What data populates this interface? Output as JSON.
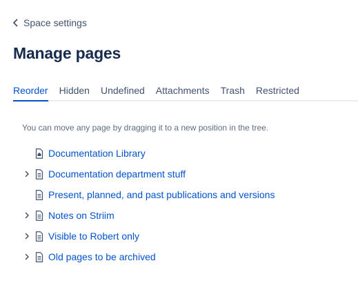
{
  "header": {
    "back_label": "Space settings",
    "title": "Manage pages"
  },
  "tabs": [
    {
      "label": "Reorder",
      "active": true
    },
    {
      "label": "Hidden",
      "active": false
    },
    {
      "label": "Undefined",
      "active": false
    },
    {
      "label": "Attachments",
      "active": false
    },
    {
      "label": "Trash",
      "active": false
    },
    {
      "label": "Restricted",
      "active": false
    }
  ],
  "hint": "You can move any page by dragging it to a new position in the tree.",
  "tree": [
    {
      "label": "Documentation Library",
      "expandable": false,
      "icon": "home-page-icon"
    },
    {
      "label": "Documentation department stuff",
      "expandable": true,
      "icon": "page-icon"
    },
    {
      "label": "Present, planned, and past publications and versions",
      "expandable": false,
      "icon": "page-icon"
    },
    {
      "label": "Notes on Striim",
      "expandable": true,
      "icon": "page-icon"
    },
    {
      "label": "Visible to Robert only",
      "expandable": true,
      "icon": "page-icon"
    },
    {
      "label": "Old pages to be archived",
      "expandable": true,
      "icon": "page-icon"
    }
  ],
  "colors": {
    "link": "#0052cc",
    "title": "#172b4d",
    "muted": "#5e6c84",
    "tab_text": "#42526e",
    "divider": "#ebecf0"
  }
}
